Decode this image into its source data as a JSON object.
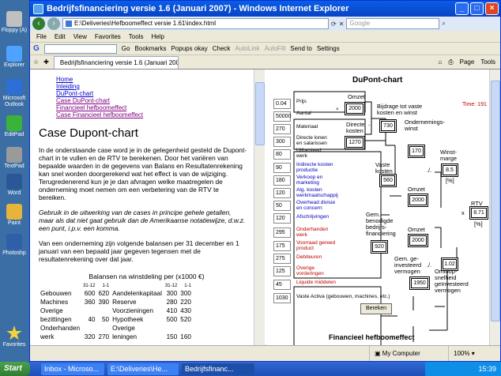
{
  "desktop_icons": [
    "Floppy (A)",
    "Explorer",
    "Microsoft Outlook",
    "EditPad",
    "TextPad",
    "Word",
    "Paint",
    "Photoshp",
    "Favorites"
  ],
  "window": {
    "title": "Bedrijfsfinanciering versie 1.6 (Januari 2007) - Windows Internet Explorer",
    "url": "E:\\Deliveries\\Hefboomeffect versie 1.61\\index.html",
    "search_placeholder": "Google",
    "menu": [
      "File",
      "Edit",
      "View",
      "Favorites",
      "Tools",
      "Help"
    ],
    "google_bar": [
      "Go",
      "Bookmarks",
      "Popups okay",
      "Check",
      "AutoLink",
      "AutoFill",
      "Send to",
      "Settings"
    ],
    "tab_title": "Bedrijfsfinanciering versie 1.6 (Januari 2007)",
    "tab_tools": [
      "Page",
      "Tools"
    ]
  },
  "left": {
    "links": [
      "Home",
      "Inleiding",
      "DuPont-chart",
      "Case DuPont-chart",
      "Financieel hefboomeffect",
      "Case Financieel hefboomeffect"
    ],
    "heading": "Case Dupont-chart",
    "para1": "In de onderstaande case word je in de gelegenheid gesteld de Dupont-chart in te vullen en de RTV te berekenen. Door het variëren van bepaalde waarden in de gegevens van Balans en Resultatenrekening kan snel worden doorgerekend wat het effect is van de wijziging. Terugredenerend kun je je dan afvragen welke maatregelen de onderneming moet nemen om een verbetering van de RTV te bereiken.",
    "para2": "Gebruik in de uitwerking van de cases in principe gehele getallen, maar als dat niet gaat gebruik dan de Amerikaanse notatiewijze, d.w.z. een punt, i.p.v. een komma.",
    "para3": "Van een onderneming zijn volgende balansen per 31 december en 1 januari van een bepaald jaar gegeven tegensen met de resultatenrekening over dat jaar.",
    "balance_title": "Balansen na winstdeling per (x1000 €)",
    "balance_hdr": [
      "31-12",
      "1-1",
      "31-12",
      "1-1"
    ],
    "balance_rows": [
      [
        "Gebouwen",
        "600",
        "620",
        "Aandelenkapitaal",
        "300",
        "300"
      ],
      [
        "Machines",
        "360",
        "390",
        "Reserve",
        "280",
        "220"
      ],
      [
        "Overige",
        "",
        "",
        "Voorzieningen",
        "410",
        "430"
      ],
      [
        "  bezittingen",
        "40",
        "50",
        "Hypotheek",
        "500",
        "520"
      ],
      [
        "Onderhanden",
        "",
        "",
        "Overige",
        "",
        ""
      ],
      [
        "  werk",
        "320",
        "270",
        "leningen",
        "150",
        "160"
      ]
    ]
  },
  "right": {
    "title": "DuPont-chart",
    "timer": "Time: 191",
    "inputs": [
      "0.04",
      "50000",
      "270",
      "300",
      "80",
      "90",
      "180",
      "120",
      "50",
      "120",
      "295",
      "175",
      "275",
      "125",
      "45",
      "1030"
    ],
    "labels": [
      "Prijs",
      "Aantal",
      "Materiaal",
      "Directe lonen en salarissen",
      "Uitbesteed werk",
      "Indirecte kosten productie",
      "Verkoop en marketing",
      "Alg. kosten werkmaatschappij",
      "Overhead divisie en concern",
      "Afschrijvingen",
      "Onderhanden werk",
      "Voorraad gereed product",
      "Debiteuren",
      "Overige vorderingen",
      "Liquide middelen",
      "Vaste Activa (gebouwen, machines, etc.)"
    ],
    "res_labels": [
      "Omzet",
      "Directe kosten",
      "Bijdrage tot vaste kosten en winst",
      "Omzet",
      "Ondernemings-winst",
      "Vaste kosten",
      "Winst-marge",
      "Omzet",
      "RTV",
      "Gem. benodigde bedrijfs-financiering",
      "Omzet",
      "Gem. ge-investeerd vermogen",
      "Omloop-snelheid geïnvesteerd vermogen"
    ],
    "res_values": [
      "2000",
      "1270",
      "730",
      "170",
      "560",
      "8.5",
      "2000",
      "8.71",
      "920",
      "2000",
      "1950",
      "1.02"
    ],
    "units": [
      "[%]",
      "[%]"
    ],
    "ops": [
      "./.",
      "./.",
      "x",
      "./."
    ],
    "button": "Bereken",
    "cut_heading": "Financieel hefboomeffect"
  },
  "status": {
    "zone": "My Computer",
    "zoom": "100%"
  },
  "taskbar": {
    "start": "Start",
    "tasks": [
      "Inbox - Microso...",
      "E:\\Deliveries\\He...",
      "Bedrijfsfinanc..."
    ],
    "time": "15:39"
  }
}
